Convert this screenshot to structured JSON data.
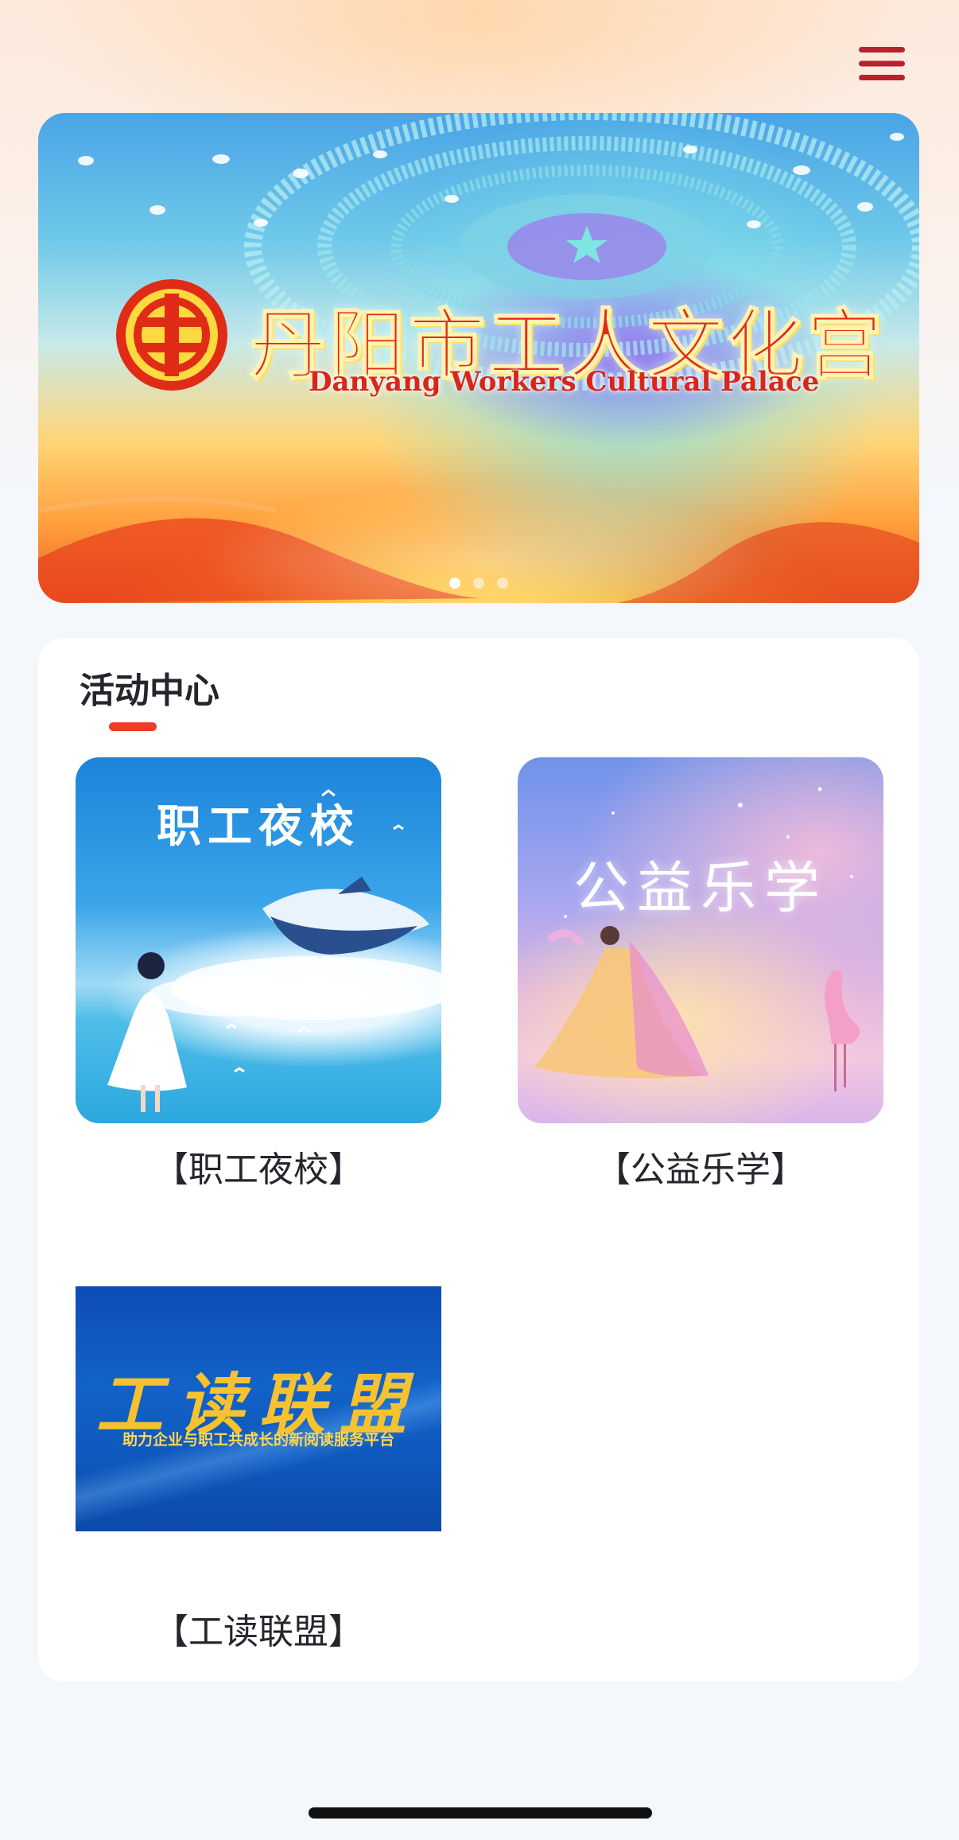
{
  "header": {
    "menu_icon": "hamburger-menu-icon",
    "accent_color": "#b5232e"
  },
  "banner": {
    "title": "丹阳市工人文化宫",
    "subtitle": "Danyang Workers Cultural Palace",
    "slides_count": 3,
    "active_slide": 1
  },
  "activity_center": {
    "title": "活动中心",
    "accent_color": "#ee3c28",
    "items": [
      {
        "caption": "【职工夜校】",
        "image_text": "职工夜校"
      },
      {
        "caption": "【公益乐学】",
        "image_text": "公益乐学"
      },
      {
        "caption": "【工读联盟】",
        "image_text": "工读联盟",
        "image_subtext": "助力企业与职工共成长的新阅读服务平台"
      }
    ]
  }
}
